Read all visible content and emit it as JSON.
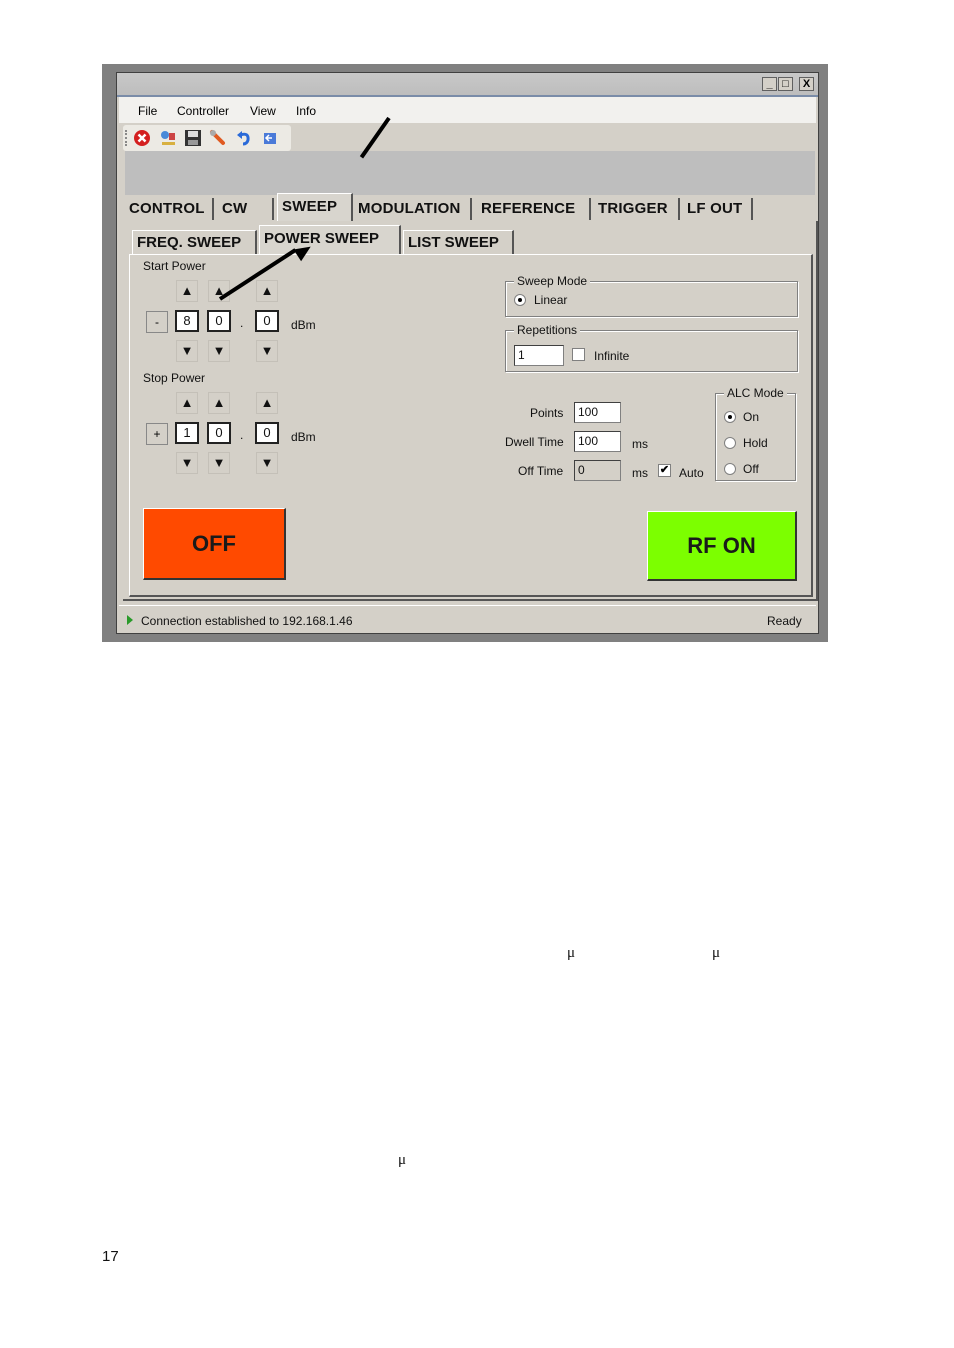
{
  "window": {
    "title": "",
    "controls": {
      "minimize": "_",
      "maximize": "□",
      "close": "X"
    }
  },
  "menu": [
    "File",
    "Controller",
    "View",
    "Info"
  ],
  "toolbar": {
    "icons": [
      "stop-icon",
      "network-icon",
      "save-icon",
      "wrench-icon",
      "undo-icon",
      "exit-icon"
    ]
  },
  "tabs": [
    "CONTROL",
    "CW",
    "SWEEP",
    "MODULATION",
    "REFERENCE",
    "TRIGGER",
    "LF OUT"
  ],
  "active_tab": "SWEEP",
  "subtabs": [
    "FREQ. SWEEP",
    "POWER SWEEP",
    "LIST SWEEP"
  ],
  "active_subtab": "POWER SWEEP",
  "start_power": {
    "label": "Start Power",
    "sign": "-",
    "digits": [
      "8",
      "0",
      "0"
    ],
    "decimal": ".",
    "unit": "dBm"
  },
  "stop_power": {
    "label": "Stop Power",
    "sign": "+",
    "digits": [
      "1",
      "0",
      "0"
    ],
    "decimal": ".",
    "unit": "dBm"
  },
  "spin": {
    "up": "▲",
    "down": "▼"
  },
  "sweep_mode": {
    "legend": "Sweep Mode",
    "option": "Linear",
    "selected": true
  },
  "repetitions": {
    "legend": "Repetitions",
    "value": "1",
    "infinite_label": "Infinite",
    "infinite_checked": false
  },
  "params": {
    "points_label": "Points",
    "points_value": "100",
    "dwell_label": "Dwell Time",
    "dwell_value": "100",
    "dwell_unit": "ms",
    "off_label": "Off Time",
    "off_value": "0",
    "off_unit": "ms",
    "auto_label": "Auto",
    "auto_checked": true,
    "auto_check_glyph": "✔"
  },
  "alc_mode": {
    "legend": "ALC Mode",
    "options": [
      "On",
      "Hold",
      "Off"
    ],
    "selected": "On"
  },
  "buttons": {
    "off_label": "OFF",
    "off_color": "#ff4a00",
    "rf_on_label": "RF ON",
    "rf_on_color": "#7cff00"
  },
  "status": {
    "message": "Connection established to 192.168.1.46",
    "state": "Ready"
  },
  "document": {
    "mu_symbols": [
      "μ",
      "μ",
      "μ"
    ],
    "page_number": "17"
  }
}
